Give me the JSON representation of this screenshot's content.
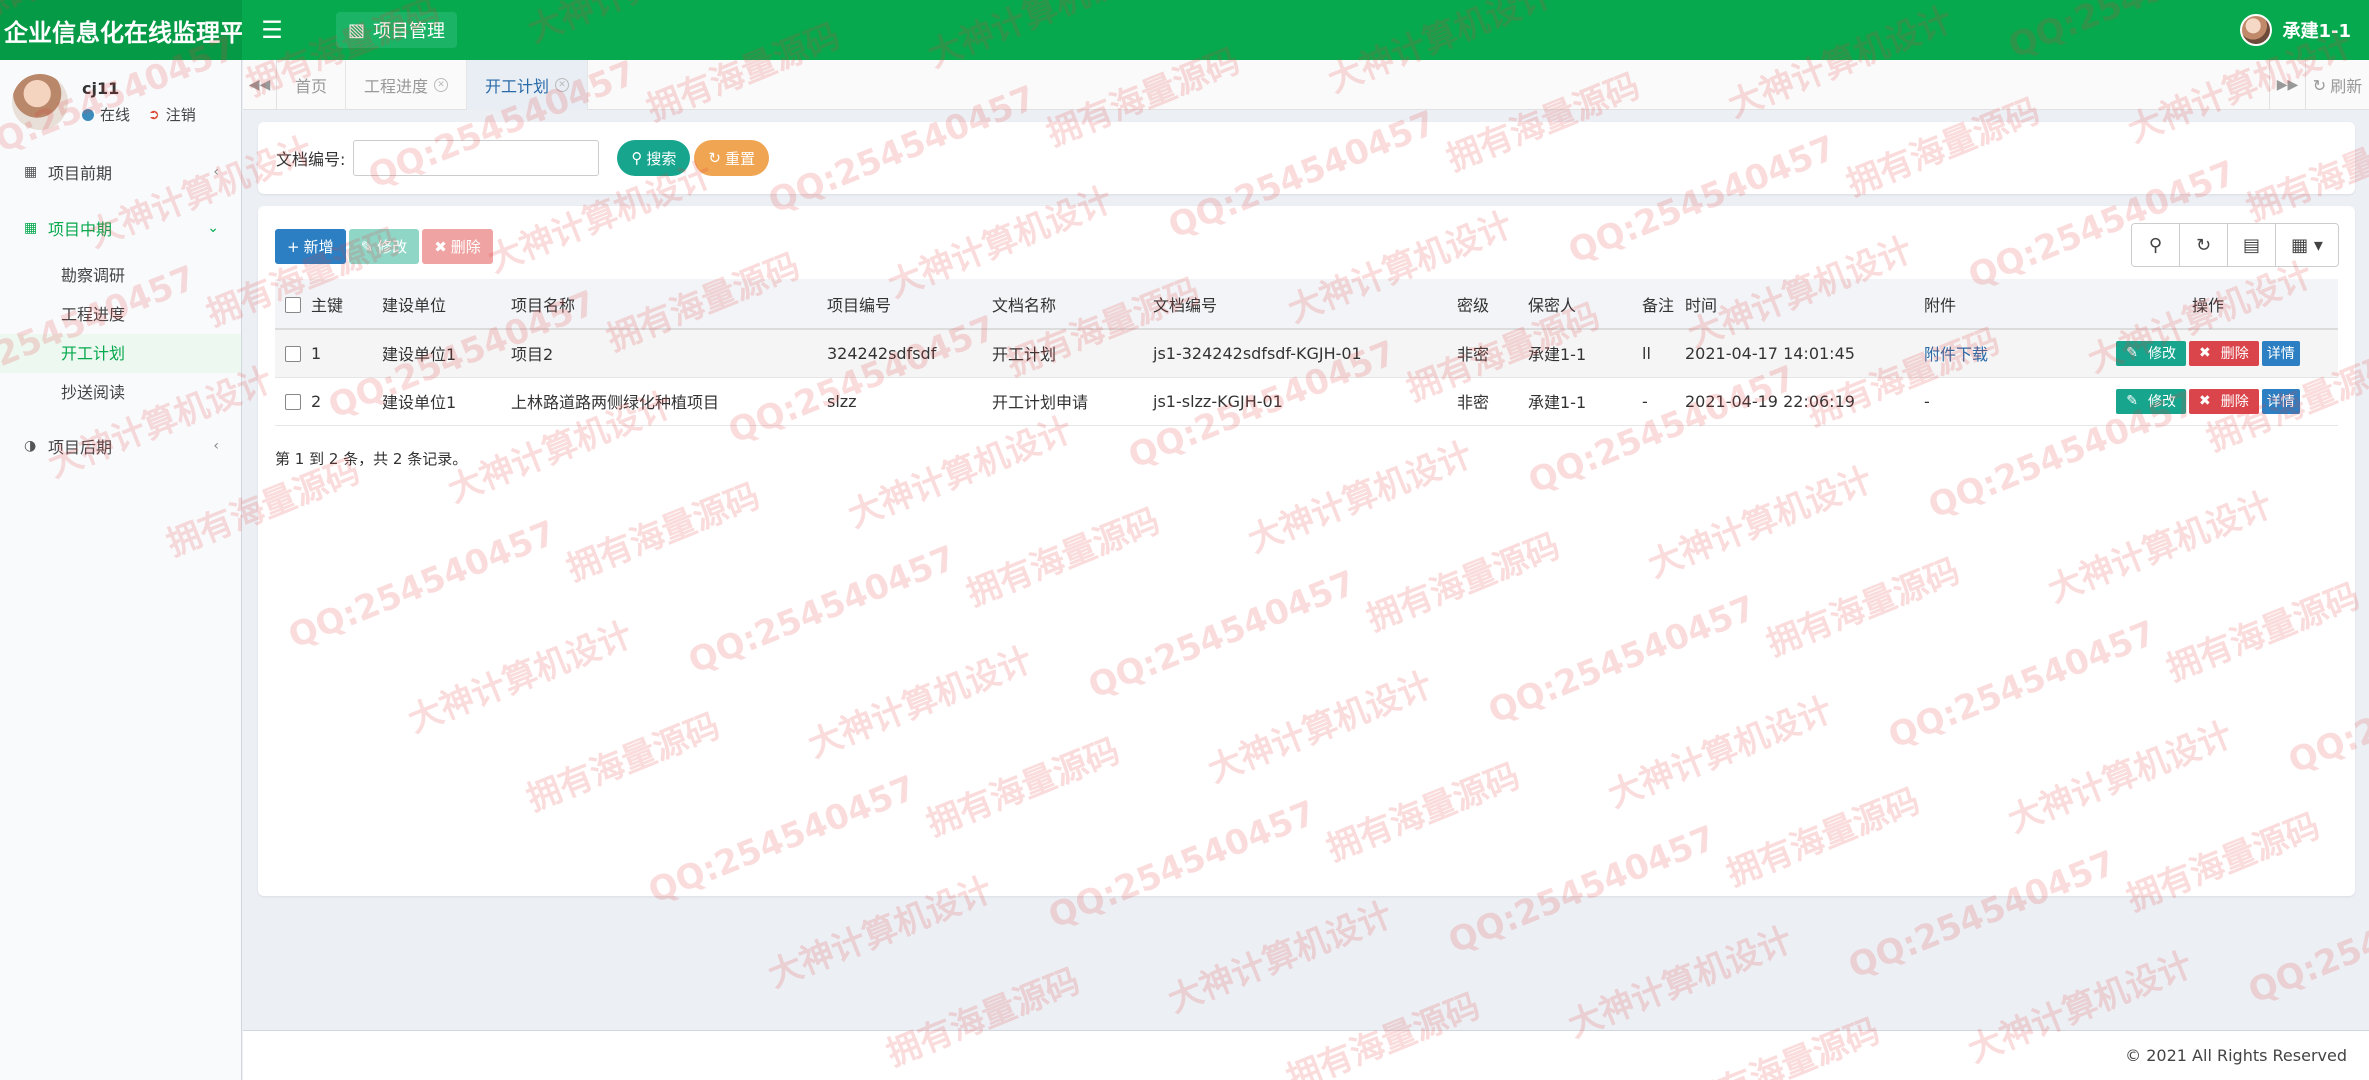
{
  "app": {
    "title": "企业信息化在线监理平台",
    "nav_button": "项目管理",
    "user": "承建1-1"
  },
  "sidebar": {
    "username": "cj11",
    "status": "在线",
    "logout": "注销",
    "groups": [
      {
        "label": "项目前期"
      },
      {
        "label": "项目中期",
        "items": [
          "勘察调研",
          "工程进度",
          "开工计划",
          "抄送阅读"
        ]
      },
      {
        "label": "项目后期"
      }
    ]
  },
  "tabs": {
    "items": [
      "首页",
      "工程进度",
      "开工计划"
    ],
    "refresh": "刷新"
  },
  "search": {
    "label": "文档编号:",
    "value": "",
    "search_button": "搜索",
    "reset_button": "重置"
  },
  "toolbar": {
    "add": "新增",
    "edit": "修改",
    "delete": "删除"
  },
  "table": {
    "headers": [
      "主键",
      "建设单位",
      "项目名称",
      "项目编号",
      "文档名称",
      "文档编号",
      "密级",
      "保密人",
      "备注",
      "时间",
      "附件",
      "操作"
    ],
    "rows": [
      [
        "1",
        "建设单位1",
        "项目2",
        "324242sdfsdf",
        "开工计划",
        "js1-324242sdfsdf-KGJH-01",
        "非密",
        "承建1-1",
        "ll",
        "2021-04-17 14:01:45",
        "附件下载"
      ],
      [
        "2",
        "建设单位1",
        "上林路道路两侧绿化种植项目",
        "slzz",
        "开工计划申请",
        "js1-slzz-KGJH-01",
        "非密",
        "承建1-1",
        "-",
        "2021-04-19 22:06:19",
        "-"
      ]
    ],
    "row_actions": {
      "edit": "修改",
      "delete": "删除",
      "detail": "详情"
    },
    "pager": "第 1 到 2 条，共 2 条记录。"
  },
  "footer": "© 2021 All Rights Reserved",
  "watermark": [
    "QQ:254540457",
    "拥有海量源码",
    "大神计算机设计"
  ],
  "colors": {
    "brand": "#06a94d",
    "link": "#2a6aa8",
    "danger": "#d9454b",
    "teal": "#17a58e",
    "primary": "#2b7fc2"
  }
}
